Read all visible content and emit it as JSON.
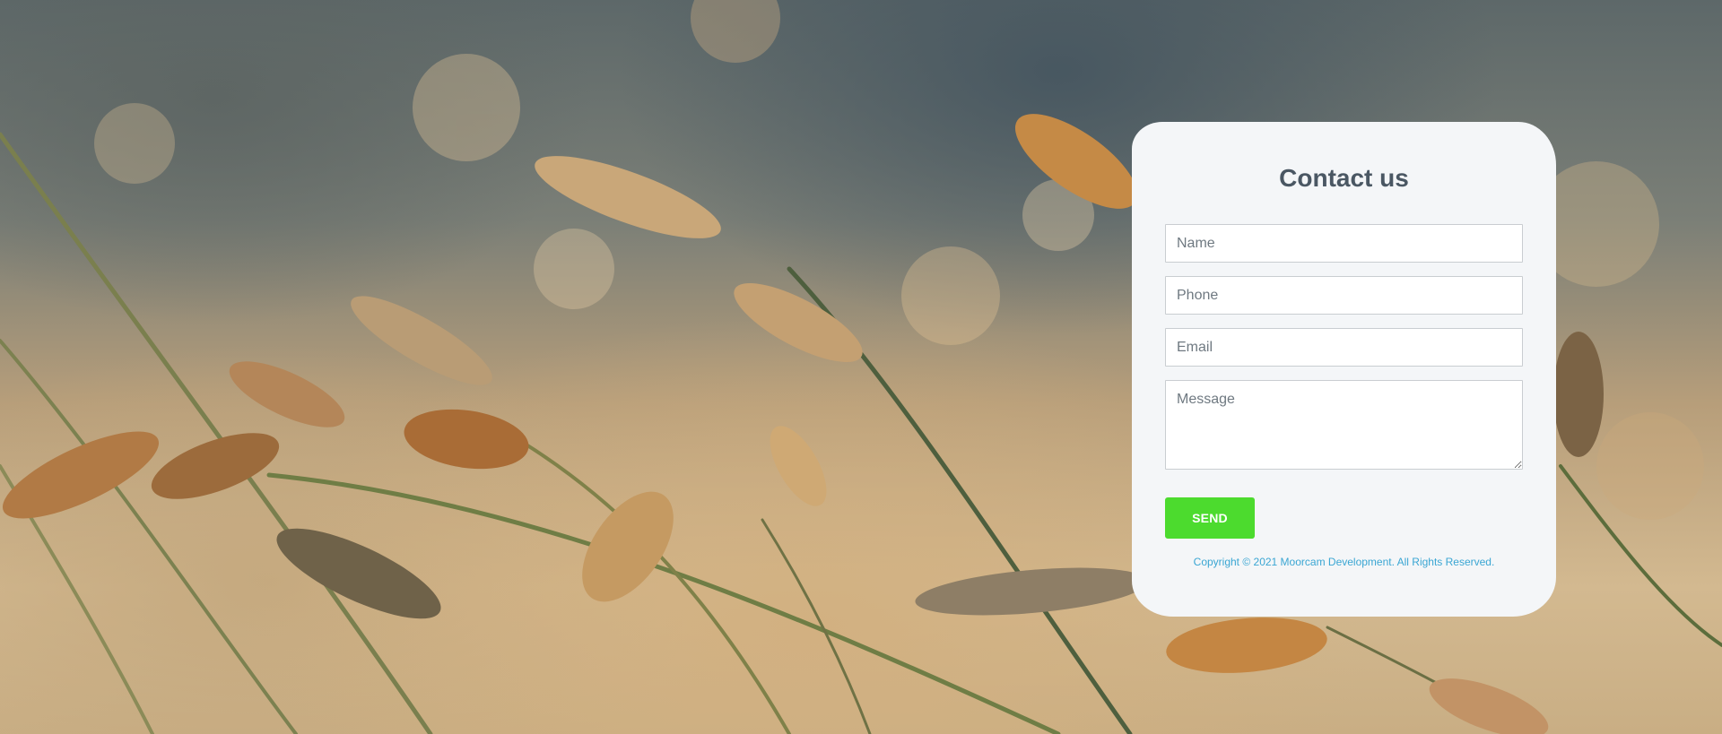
{
  "contact_form": {
    "title": "Contact us",
    "name_placeholder": "Name",
    "phone_placeholder": "Phone",
    "email_placeholder": "Email",
    "message_placeholder": "Message",
    "send_label": "SEND",
    "copyright": "Copyright © 2021 Moorcam Development. All Rights Reserved."
  },
  "colors": {
    "card_background": "#f4f6f8",
    "title": "#4a5763",
    "send_button": "#4cdb2e",
    "copyright": "#3aa6d3"
  },
  "background_image": "wheat-grass-field-photo"
}
